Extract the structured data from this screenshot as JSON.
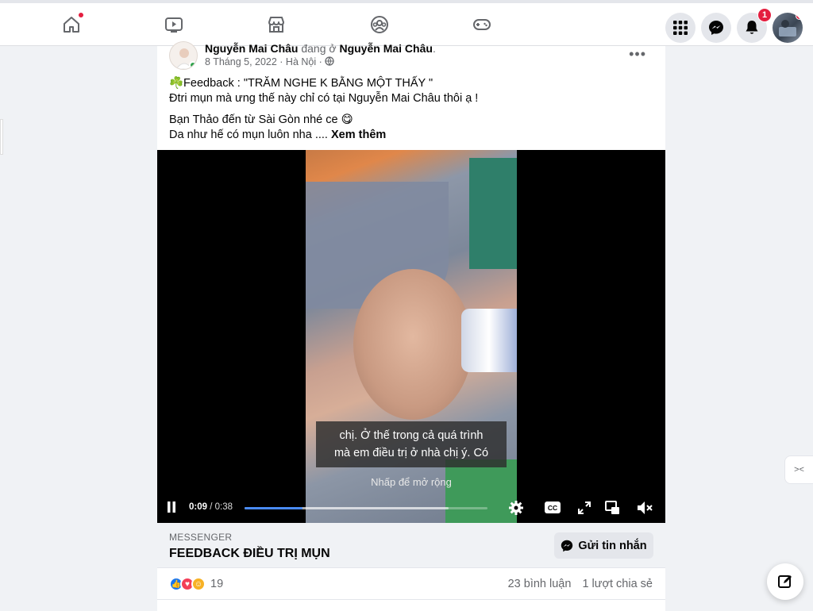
{
  "nav": {
    "home_notification": true,
    "notifications_count": "1"
  },
  "post": {
    "author": "Nguyễn Mai Châu",
    "at_word": "đang ở",
    "location_page": "Nguyễn Mai Châu",
    "date": "8 Tháng 5, 2022 · Hà Nội ·",
    "text_line1": "☘️Feedback : \"TRĂM NGHE K BẰNG MỘT THẤY \"",
    "text_line2": "Đtri mụn mà ưng thế này chỉ có tại Nguyễn Mai Châu thôi ạ !",
    "text_line3": "Bạn Thảo đến từ Sài Gòn nhé ce 😋",
    "text_line4": "Da như  hế có mụn luôn nha ....",
    "see_more": "Xem thêm"
  },
  "video": {
    "subtitle_line1": "chị. Ở thế trong cả quá trình",
    "subtitle_line2": "mà em điều trị ở nhà chị ý. Có",
    "tap_hint": "Nhấp để mở rộng",
    "current_time": "0:09",
    "duration": "/ 0:38",
    "progress": 0.237,
    "buffered": 0.84,
    "accent": "#4a8bf5"
  },
  "messenger": {
    "kicker": "MESSENGER",
    "title": "FEEDBACK ĐIỀU TRỊ MỤN",
    "button": "Gửi tin nhắn"
  },
  "stats": {
    "reaction_count": "19",
    "comments": "23 bình luận",
    "shares": "1 lượt chia sẻ"
  },
  "colors": {
    "brand": "#1877f2",
    "notification": "#e41e3f"
  }
}
